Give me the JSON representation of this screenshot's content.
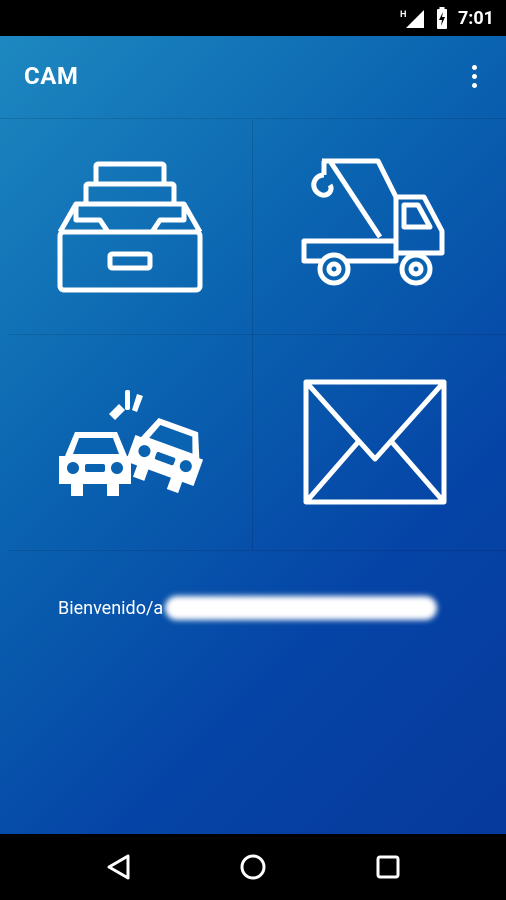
{
  "status_bar": {
    "time": "7:01",
    "icons": [
      "network-h-icon",
      "signal-icon",
      "battery-charging-icon"
    ]
  },
  "app_bar": {
    "title": "CAM",
    "menu_icon": "overflow-menu-icon"
  },
  "grid": {
    "tiles": [
      {
        "icon": "file-drawer-icon"
      },
      {
        "icon": "tow-truck-icon"
      },
      {
        "icon": "car-crash-icon"
      },
      {
        "icon": "envelope-icon"
      }
    ]
  },
  "welcome": {
    "prefix": "Bienvenido/a"
  },
  "nav_bar": {
    "buttons": [
      "back-icon",
      "home-icon",
      "recents-icon"
    ]
  },
  "colors": {
    "gradient_start": "#1d88c0",
    "gradient_end": "#063a9c",
    "icon": "#ffffff"
  }
}
